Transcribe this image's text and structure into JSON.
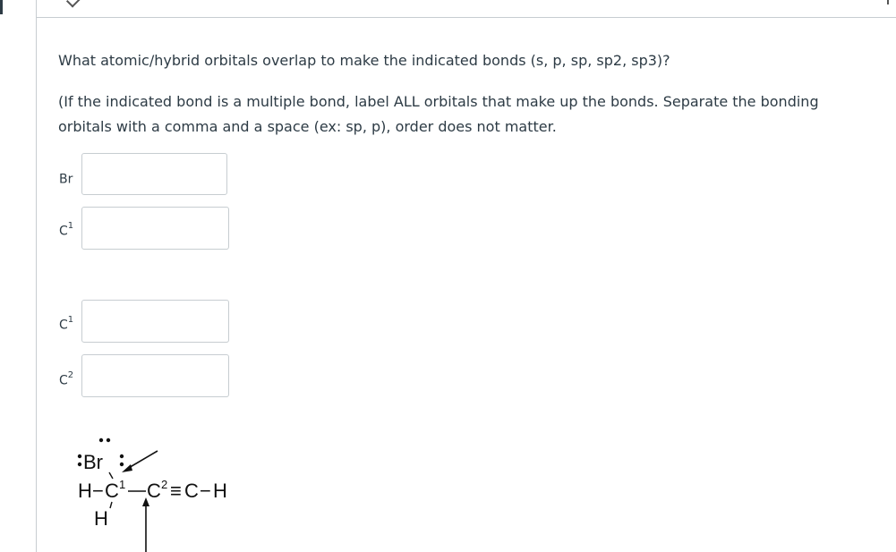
{
  "question": {
    "line1": "What atomic/hybrid orbitals overlap to make the indicated bonds (s, p, sp, sp2, sp3)?",
    "line2": "(If the indicated bond is a multiple bond, label ALL orbitals that make up the bonds. Separate the bonding orbitals with a comma and a space (ex: sp, p), order does not matter."
  },
  "answers": [
    {
      "label": "Br",
      "sup": "",
      "value": ""
    },
    {
      "label": "C",
      "sup": "1",
      "value": ""
    },
    {
      "label": "C",
      "sup": "1",
      "value": ""
    },
    {
      "label": "C",
      "sup": "2",
      "value": ""
    }
  ],
  "structure": {
    "br": "Br",
    "h": "H",
    "c": "C",
    "c1_sup": "1",
    "c2_sup": "2",
    "minus": "−",
    "triple": "≡"
  }
}
